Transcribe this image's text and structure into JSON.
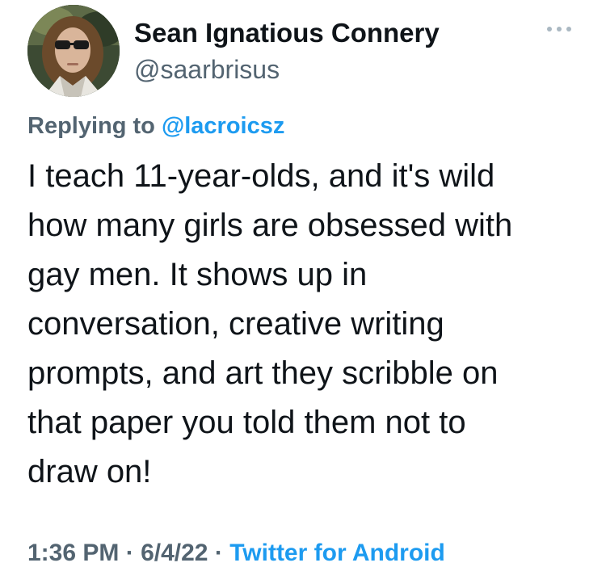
{
  "tweet": {
    "author": {
      "display_name": "Sean Ignatious Connery",
      "handle": "@saarbrisus"
    },
    "more_icon": "more-dots-icon",
    "replying_prefix": "Replying to",
    "replying_to": "@lacroicsz",
    "text": "I teach 11-year-olds, and it's wild\nhow many girls are obsessed with\ngay men. It shows up in\nconversation, creative writing\nprompts, and art they scribble on\nthat paper you told them not to\ndraw on!",
    "time": "1:36 PM",
    "separator": "·",
    "date": "6/4/22",
    "source": "Twitter for Android"
  },
  "colors": {
    "text": "#0f1419",
    "secondary": "#536471",
    "link": "#1d9bf0"
  }
}
